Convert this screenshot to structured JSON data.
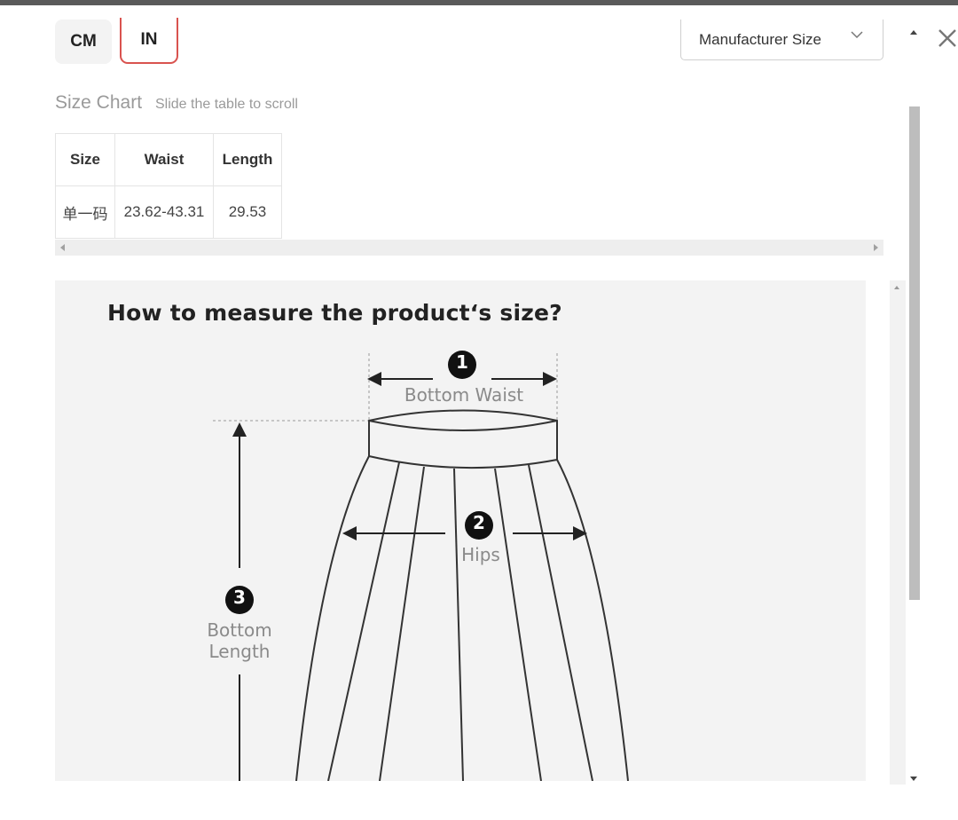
{
  "units": {
    "cm_label": "CM",
    "in_label": "IN",
    "selected": "IN",
    "accent": "#d9534f"
  },
  "size_system": {
    "selected_label": "Manufacturer Size"
  },
  "size_chart": {
    "title": "Size Chart",
    "hint": "Slide the table to scroll",
    "headers": [
      "Size",
      "Waist",
      "Length"
    ],
    "rows": [
      [
        "单一码",
        "23.62-43.31",
        "29.53"
      ]
    ]
  },
  "measure_guide": {
    "title": "How to measure the product‘s size?",
    "items": [
      {
        "number": "1",
        "label": "Bottom Waist"
      },
      {
        "number": "2",
        "label": "Hips"
      },
      {
        "number": "3",
        "label_line1": "Bottom",
        "label_line2": "Length"
      }
    ]
  },
  "icons": {
    "close": "close-icon",
    "dropdown": "chevron-down-icon"
  }
}
